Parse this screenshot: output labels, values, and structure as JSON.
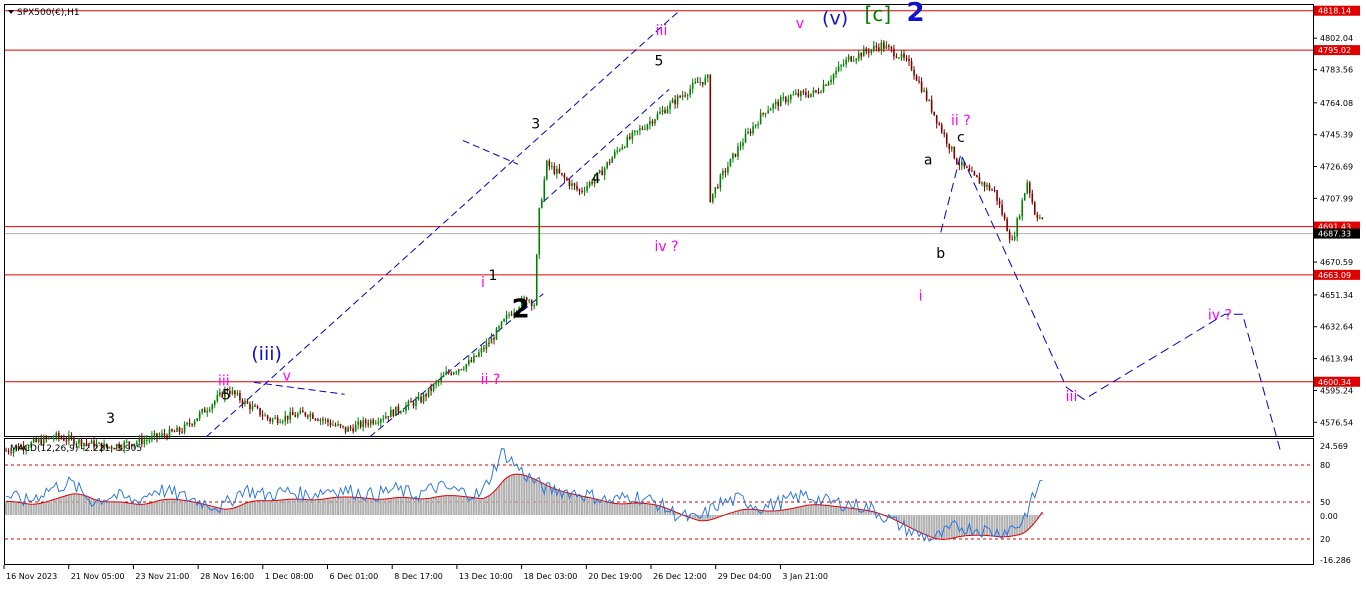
{
  "window": {
    "title": "SPX500(€),H1"
  },
  "colors": {
    "background": "#ffffff",
    "frame": "#000000",
    "grid": "#c0c0c0",
    "bull_candle": "#008000",
    "bear_candle": "#800000",
    "hline": "#e00000",
    "bid_line": "#b0b0b0",
    "channel": "#0000cc",
    "magenta": "#ff00ff",
    "wave_blue": "#1111cc",
    "wave_green": "#008000",
    "black": "#000000",
    "macd_hist": "#b0b0b0",
    "macd_line": "#1e6fe0",
    "signal_line": "#e00000"
  },
  "chart_data": [
    {
      "type": "candlestick",
      "symbol": "SPX500(€)",
      "timeframe": "H1",
      "ylim": [
        4568.5,
        4821.5
      ],
      "x_tick_labels": [
        "16 Nov 2023",
        "21 Nov 05:00",
        "23 Nov 21:00",
        "28 Nov 16:00",
        "1 Dec 08:00",
        "6 Dec 01:00",
        "8 Dec 17:00",
        "13 Dec 10:00",
        "18 Dec 03:00",
        "20 Dec 19:00",
        "26 Dec 12:00",
        "29 Dec 04:00",
        "3 Jan 21:00"
      ],
      "y_tick_labels": [
        "4802.04",
        "4783.56",
        "4764.08",
        "4745.39",
        "4726.69",
        "4707.99",
        "4670.59",
        "4651.34",
        "4632.64",
        "4613.94",
        "4595.24",
        "4576.54"
      ],
      "price_guide_points": [
        [
          0,
          4560
        ],
        [
          20,
          4568
        ],
        [
          40,
          4562
        ],
        [
          55,
          4566
        ],
        [
          70,
          4572
        ],
        [
          80,
          4585
        ],
        [
          88,
          4596
        ],
        [
          95,
          4588
        ],
        [
          105,
          4578
        ],
        [
          120,
          4582
        ],
        [
          135,
          4572
        ],
        [
          150,
          4580
        ],
        [
          165,
          4590
        ],
        [
          175,
          4605
        ],
        [
          185,
          4612
        ],
        [
          193,
          4625
        ],
        [
          200,
          4640
        ],
        [
          207,
          4650
        ],
        [
          210,
          4646
        ],
        [
          212,
          4700
        ],
        [
          215,
          4728
        ],
        [
          220,
          4722
        ],
        [
          228,
          4712
        ],
        [
          236,
          4722
        ],
        [
          244,
          4738
        ],
        [
          255,
          4752
        ],
        [
          265,
          4764
        ],
        [
          275,
          4776
        ],
        [
          279,
          4778
        ],
        [
          280,
          4708
        ],
        [
          285,
          4722
        ],
        [
          293,
          4742
        ],
        [
          302,
          4760
        ],
        [
          312,
          4768
        ],
        [
          322,
          4770
        ],
        [
          335,
          4790
        ],
        [
          348,
          4798
        ],
        [
          355,
          4792
        ],
        [
          360,
          4785
        ],
        [
          365,
          4770
        ],
        [
          372,
          4748
        ],
        [
          378,
          4730
        ],
        [
          385,
          4720
        ],
        [
          393,
          4712
        ],
        [
          400,
          4682
        ],
        [
          406,
          4718
        ],
        [
          409,
          4700
        ],
        [
          412,
          4695
        ]
      ],
      "horizontal_levels": [
        {
          "value": 4818.14,
          "label": "4818.14"
        },
        {
          "value": 4795.02,
          "label": "4795.02"
        },
        {
          "value": 4691.43,
          "label": "4691.43"
        },
        {
          "value": 4663.09,
          "label": "4663.09"
        },
        {
          "value": 4600.34,
          "label": "4600.34"
        }
      ],
      "bid_line": {
        "value": 4687.33,
        "label": "4687.33"
      },
      "wave_labels": [
        {
          "text": "3",
          "color": "black",
          "x_idx": 42,
          "price": 4576
        },
        {
          "text": "5",
          "color": "black",
          "x_idx": 88,
          "price": 4590
        },
        {
          "text": "iii",
          "color": "magenta",
          "x_idx": 87,
          "price": 4598
        },
        {
          "text": "(iii)",
          "color": "wave_blue",
          "x_idx": 104,
          "price": 4613
        },
        {
          "text": "v",
          "color": "magenta",
          "x_idx": 112,
          "price": 4601
        },
        {
          "text": "i",
          "color": "magenta",
          "x_idx": 190,
          "price": 4656
        },
        {
          "text": "1",
          "color": "black",
          "x_idx": 194,
          "price": 4660
        },
        {
          "text": "2",
          "color": "black",
          "x_idx": 205,
          "price": 4638
        },
        {
          "text": "ii ?",
          "color": "magenta",
          "x_idx": 193,
          "price": 4599
        },
        {
          "text": "3",
          "color": "black",
          "x_idx": 211,
          "price": 4749
        },
        {
          "text": "4",
          "color": "black",
          "x_idx": 235,
          "price": 4717
        },
        {
          "text": "5",
          "color": "black",
          "x_idx": 260,
          "price": 4786
        },
        {
          "text": "iii",
          "color": "magenta",
          "x_idx": 261,
          "price": 4804
        },
        {
          "text": "iv ?",
          "color": "magenta",
          "x_idx": 263,
          "price": 4677
        },
        {
          "text": "v",
          "color": "magenta",
          "x_idx": 316,
          "price": 4808
        },
        {
          "text": "(v)",
          "color": "wave_blue",
          "x_idx": 330,
          "price": 4810
        },
        {
          "text": "[c]",
          "color": "wave_green",
          "x_idx": 347,
          "price": 4812
        },
        {
          "text": "2",
          "color": "wave_blue",
          "x_idx": 362,
          "price": 4812
        },
        {
          "text": "a",
          "color": "black",
          "x_idx": 367,
          "price": 4728
        },
        {
          "text": "c",
          "color": "black",
          "x_idx": 380,
          "price": 4741
        },
        {
          "text": "ii ?",
          "color": "magenta",
          "x_idx": 380,
          "price": 4751
        },
        {
          "text": "b",
          "color": "black",
          "x_idx": 372,
          "price": 4673
        },
        {
          "text": "i",
          "color": "magenta",
          "x_idx": 364,
          "price": 4648
        },
        {
          "text": "iii",
          "color": "magenta",
          "x_idx": 424,
          "price": 4589
        },
        {
          "text": "iv ?",
          "color": "magenta",
          "x_idx": 483,
          "price": 4637
        }
      ],
      "projection_path": [
        [
          372,
          4688
        ],
        [
          380,
          4734
        ],
        [
          422,
          4597
        ],
        [
          429,
          4590
        ],
        [
          485,
          4640
        ],
        [
          492,
          4640
        ],
        [
          507,
          4560
        ]
      ]
    },
    {
      "type": "line",
      "title": "MACD(12,26,9) -2.221 -3.905",
      "series": [
        {
          "name": "MACD",
          "values_note": "oscillator"
        },
        {
          "name": "Signal",
          "values_note": "oscillator"
        }
      ],
      "y_tick_labels": [
        "24.569",
        "80",
        "50",
        "0.00",
        "20",
        "-16.286"
      ],
      "reference_levels": [
        80,
        50,
        20
      ],
      "macd_line_guide": [
        0.55,
        0.5,
        0.6,
        0.65,
        0.5,
        0.55,
        0.5,
        0.6,
        0.55,
        0.5,
        0.45,
        0.6,
        0.55,
        0.58,
        0.55,
        0.6,
        0.58,
        0.55,
        0.6,
        0.55,
        0.62,
        0.58,
        0.55,
        0.9,
        0.72,
        0.6,
        0.58,
        0.55,
        0.5,
        0.55,
        0.5,
        0.4,
        0.35,
        0.48,
        0.52,
        0.45,
        0.5,
        0.55,
        0.5,
        0.48,
        0.45,
        0.35,
        0.25,
        0.2,
        0.3,
        0.28,
        0.25,
        0.32,
        0.68
      ]
    }
  ]
}
